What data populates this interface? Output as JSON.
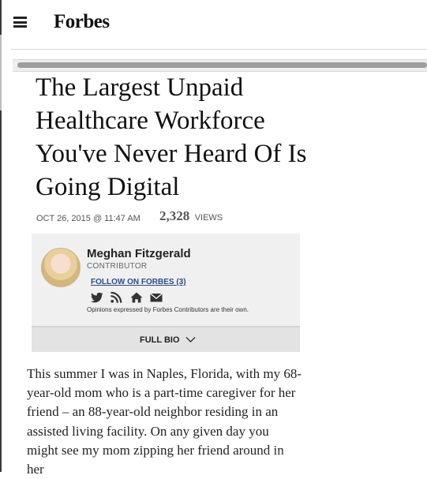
{
  "header": {
    "brand": "Forbes",
    "menu_icon": "hamburger-menu-icon"
  },
  "article": {
    "title": "The Largest Unpaid Healthcare Workforce You've Never Heard Of Is Going Digital",
    "date": "OCT 26, 2015 @ 11:47 AM",
    "views_count": "2,328",
    "views_label": "VIEWS"
  },
  "author": {
    "name": "Meghan Fitzgerald",
    "role": "CONTRIBUTOR",
    "follow_label": "FOLLOW ON FORBES (3)",
    "social_icons": [
      "twitter-icon",
      "rss-icon",
      "home-icon",
      "email-icon"
    ],
    "disclaimer": "Opinions expressed by Forbes Contributors are their own.",
    "full_bio_label": "FULL BIO"
  },
  "body": {
    "paragraph_1": "This summer I was in Naples, Florida, with my 68-year-old mom who is a part-time caregiver for her friend – an 88-year-old neighbor residing in an assisted living facility. On any given day you might see my mom zipping her friend around in her"
  },
  "colors": {
    "link": "#2a4c8b",
    "card_bg": "#f0f0f0",
    "bio_bar_bg": "#e3e3e3"
  }
}
